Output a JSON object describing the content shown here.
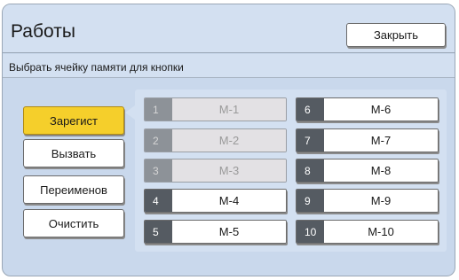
{
  "window": {
    "title": "Работы"
  },
  "header": {
    "close_label": "Закрыть"
  },
  "subtitle": "Выбрать ячейку памяти для кнопки",
  "functions": [
    {
      "label": "Зарегист",
      "active": true
    },
    {
      "label": "Вызвать",
      "active": false
    },
    {
      "label": "Переименов",
      "active": false
    },
    {
      "label": "Очистить",
      "active": false
    }
  ],
  "slots": [
    {
      "num": "1",
      "label": "M-1",
      "enabled": false
    },
    {
      "num": "2",
      "label": "M-2",
      "enabled": false
    },
    {
      "num": "3",
      "label": "M-3",
      "enabled": false
    },
    {
      "num": "4",
      "label": "M-4",
      "enabled": true
    },
    {
      "num": "5",
      "label": "M-5",
      "enabled": true
    },
    {
      "num": "6",
      "label": "M-6",
      "enabled": true
    },
    {
      "num": "7",
      "label": "M-7",
      "enabled": true
    },
    {
      "num": "8",
      "label": "M-8",
      "enabled": true
    },
    {
      "num": "9",
      "label": "M-9",
      "enabled": true
    },
    {
      "num": "10",
      "label": "M-10",
      "enabled": true
    }
  ],
  "colors": {
    "panel_bg": "#c9d8ec",
    "active_button": "#f5cf2b",
    "slot_number_bg": "#555b62",
    "disabled_slot_bg": "#e3e1e4"
  }
}
